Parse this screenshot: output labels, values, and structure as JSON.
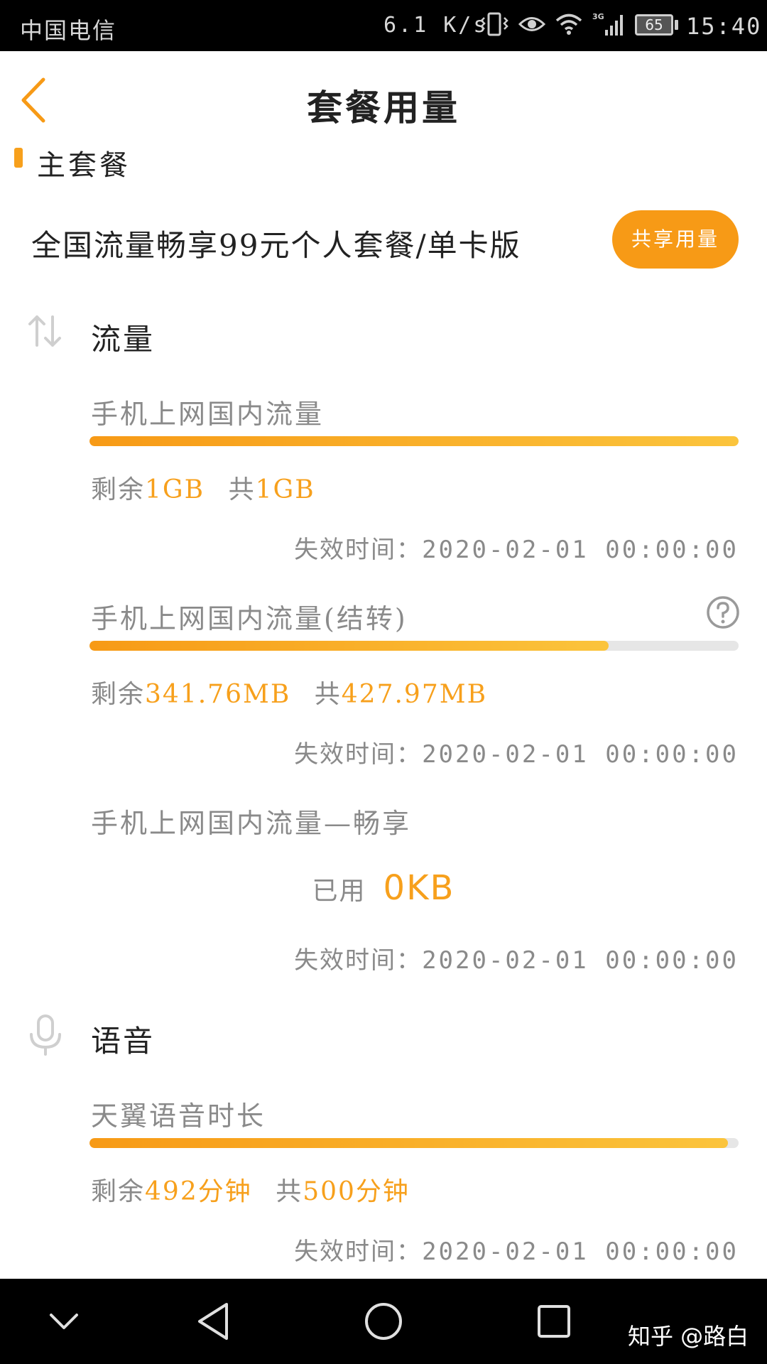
{
  "status_bar": {
    "carrier": "中国电信",
    "net_speed": "6.1 K/s",
    "network_type": "3G",
    "battery": "65",
    "time": "15:40"
  },
  "header": {
    "title": "套餐用量",
    "back_icon": "chevron-left-icon"
  },
  "main_plan": {
    "section_title": "主套餐",
    "plan_name": "全国流量畅享99元个人套餐/单卡版",
    "share_button_label": "共享用量"
  },
  "data_section": {
    "title": "流量",
    "icon": "transfer-arrows-icon",
    "items": [
      {
        "name": "手机上网国内流量",
        "remaining_label": "剩余",
        "remaining": "1GB",
        "total_label": "共",
        "total": "1GB",
        "progress_fraction": 1.0,
        "expiry_label": "失效时间：",
        "expiry": "2020-02-01 00:00:00"
      },
      {
        "name": "手机上网国内流量(结转)",
        "remaining_label": "剩余",
        "remaining": "341.76MB",
        "total_label": "共",
        "total": "427.97MB",
        "progress_fraction": 0.8,
        "expiry_label": "失效时间：",
        "expiry": "2020-02-01 00:00:00",
        "help_icon": "question-circle-icon"
      },
      {
        "name": "手机上网国内流量—畅享",
        "used_label": "已用",
        "used": "0KB",
        "expiry_label": "失效时间：",
        "expiry": "2020-02-01 00:00:00"
      }
    ]
  },
  "voice_section": {
    "title": "语音",
    "icon": "microphone-icon",
    "items": [
      {
        "name": "天翼语音时长",
        "remaining_label": "剩余",
        "remaining": "492分钟",
        "total_label": "共",
        "total": "500分钟",
        "progress_fraction": 0.984,
        "expiry_label": "失效时间：",
        "expiry": "2020-02-01 00:00:00"
      }
    ]
  },
  "nav_bar": {
    "watermark": "知乎 @路白"
  },
  "colors": {
    "accent": "#f79a16",
    "accent_light": "#fbc43c",
    "muted_text": "#8a8a8a",
    "track": "#e6e6e6"
  }
}
